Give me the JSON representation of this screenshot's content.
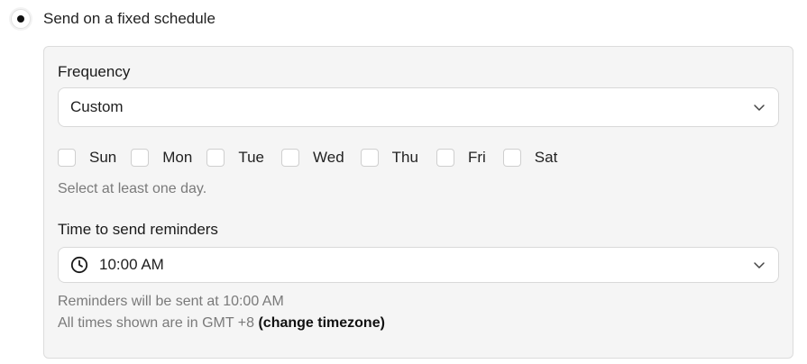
{
  "schedule_option": {
    "label": "Send on a fixed schedule",
    "selected": true
  },
  "frequency": {
    "label": "Frequency",
    "value": "Custom",
    "icon": "chevron-down-icon"
  },
  "days": [
    {
      "label": "Sun",
      "checked": false
    },
    {
      "label": "Mon",
      "checked": false
    },
    {
      "label": "Tue",
      "checked": false
    },
    {
      "label": "Wed",
      "checked": false
    },
    {
      "label": "Thu",
      "checked": false
    },
    {
      "label": "Fri",
      "checked": false
    },
    {
      "label": "Sat",
      "checked": false
    }
  ],
  "days_helper": "Select at least one day.",
  "time": {
    "label": "Time to send reminders",
    "value": "10:00 AM",
    "icon": "clock-icon"
  },
  "reminder_note": "Reminders will be sent at 10:00 AM",
  "timezone_note": "All times shown are in GMT +8",
  "timezone_link": "(change timezone)",
  "colors": {
    "panel_bg": "#f5f5f5",
    "text_primary": "#1f1f1f",
    "text_muted": "#7a7a7a",
    "radio_dot": "#111111"
  }
}
